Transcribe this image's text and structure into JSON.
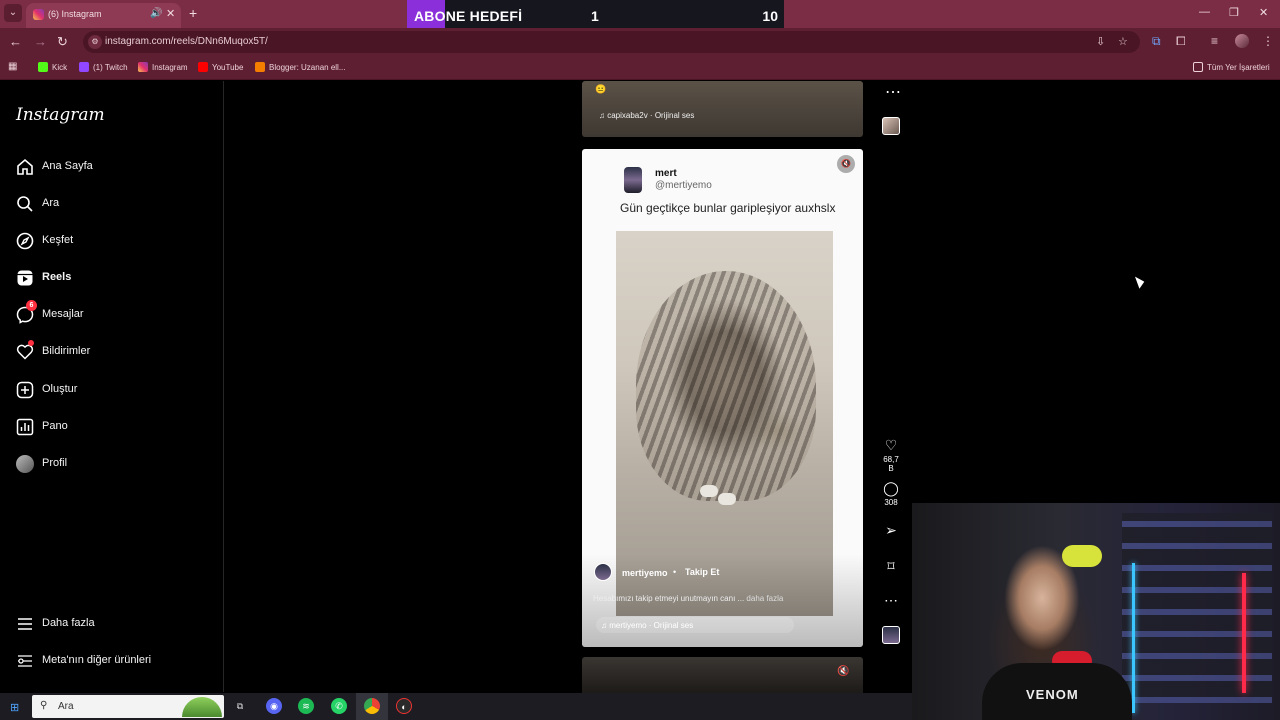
{
  "browser": {
    "tab_title": "(6) Instagram",
    "url": "instagram.com/reels/DNn6Muqox5T/",
    "bookmarks": [
      "Kick",
      "(1) Twitch",
      "Instagram",
      "YouTube",
      "Blogger: Uzanan ell..."
    ],
    "all_bookmarks": "Tüm Yer İşaretleri"
  },
  "stream_overlay": {
    "label": "ABONE HEDEFİ",
    "current": "1",
    "target": "10",
    "progress_fraction": 0.1,
    "fill_color": "#8a2fd9"
  },
  "instagram": {
    "logo": "Instagram",
    "nav": [
      {
        "label": "Ana Sayfa",
        "icon": "home-icon"
      },
      {
        "label": "Ara",
        "icon": "search-icon"
      },
      {
        "label": "Keşfet",
        "icon": "compass-icon"
      },
      {
        "label": "Reels",
        "icon": "reels-icon",
        "active": true
      },
      {
        "label": "Mesajlar",
        "icon": "messenger-icon",
        "badge": "6"
      },
      {
        "label": "Bildirimler",
        "icon": "heart-icon"
      },
      {
        "label": "Oluştur",
        "icon": "plus-square-icon"
      },
      {
        "label": "Pano",
        "icon": "dashboard-icon"
      },
      {
        "label": "Profil",
        "icon": "avatar"
      }
    ],
    "more": "Daha fazla",
    "meta": "Meta'nın diğer ürünleri"
  },
  "prev_reel": {
    "audio": "capixaba2v · Orijinal ses"
  },
  "reel": {
    "author_name": "mert",
    "author_handle": "@mertiyemo",
    "text": "Gün geçtikçe bunlar garipleşiyor auxhslx",
    "username": "mertiyemo",
    "separator": "•",
    "follow": "Takip Et",
    "caption": "Hesabımızı takip etmeyi unutmayın canı ...",
    "caption_more": "daha fazla",
    "audio": "mertiyemo · Orijinal ses",
    "likes": "68,7 B",
    "comments": "308"
  },
  "taskbar": {
    "search": "Ara"
  }
}
